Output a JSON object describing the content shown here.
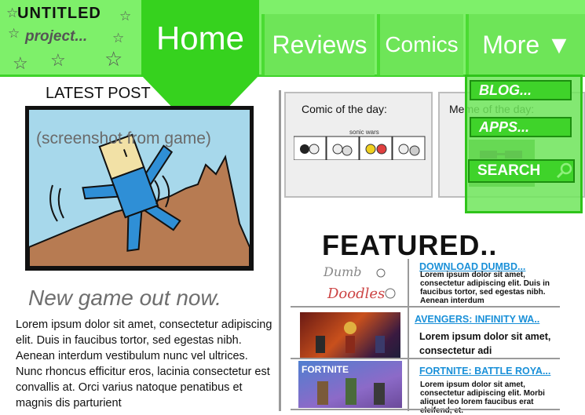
{
  "header": {
    "logo_title": "UNTITLED",
    "logo_subtitle": "project...",
    "nav": [
      "Home",
      "Reviews",
      "Comics",
      "More ▼"
    ]
  },
  "dropdown": {
    "items": [
      "BLOG...",
      "APPS..."
    ],
    "search_label": "SEARCH"
  },
  "latest_post": {
    "heading": "LATEST POST",
    "image_caption": "(screenshot from game)",
    "tagline": "New game out now.",
    "body": "Lorem ipsum dolor sit amet, consectetur adipiscing elit. Duis in faucibus tortor, sed egestas nibh. Aenean interdum vestibulum nunc vel ultrices. Nunc rhoncus efficitur eros, lacinia consectetur est convallis at. Orci varius natoque penatibus et magnis dis parturient"
  },
  "comic_of_day": {
    "title": "Comic of the day:",
    "panel_label": "sonic wars"
  },
  "meme_of_day": {
    "title": "Meme of the day:"
  },
  "featured": {
    "heading": "FEATURED..",
    "items": [
      {
        "title": "DOWNLOAD DUMBD...",
        "text": "Lorem ipsum dolor sit amet, consectetur adipiscing elit. Duis in faucibus tortor, sed egestas nibh. Aenean interdum",
        "thumb_label": "Dumb Doodles"
      },
      {
        "title": "AVENGERS: INFINITY WA..",
        "text": "Lorem ipsum dolor sit amet, consectetur adi",
        "thumb_label": ""
      },
      {
        "title": "FORTNITE: BATTLE ROYA...",
        "text": "Lorem ipsum dolor sit amet, consectetur adipiscing elit. Morbi aliquet leo lorem faucibus erat eleifend, et.",
        "thumb_label": "FORTNITE"
      }
    ]
  },
  "colors": {
    "header_green": "#7ef06a",
    "home_green": "#36d21e",
    "link_blue": "#1a90d8"
  }
}
